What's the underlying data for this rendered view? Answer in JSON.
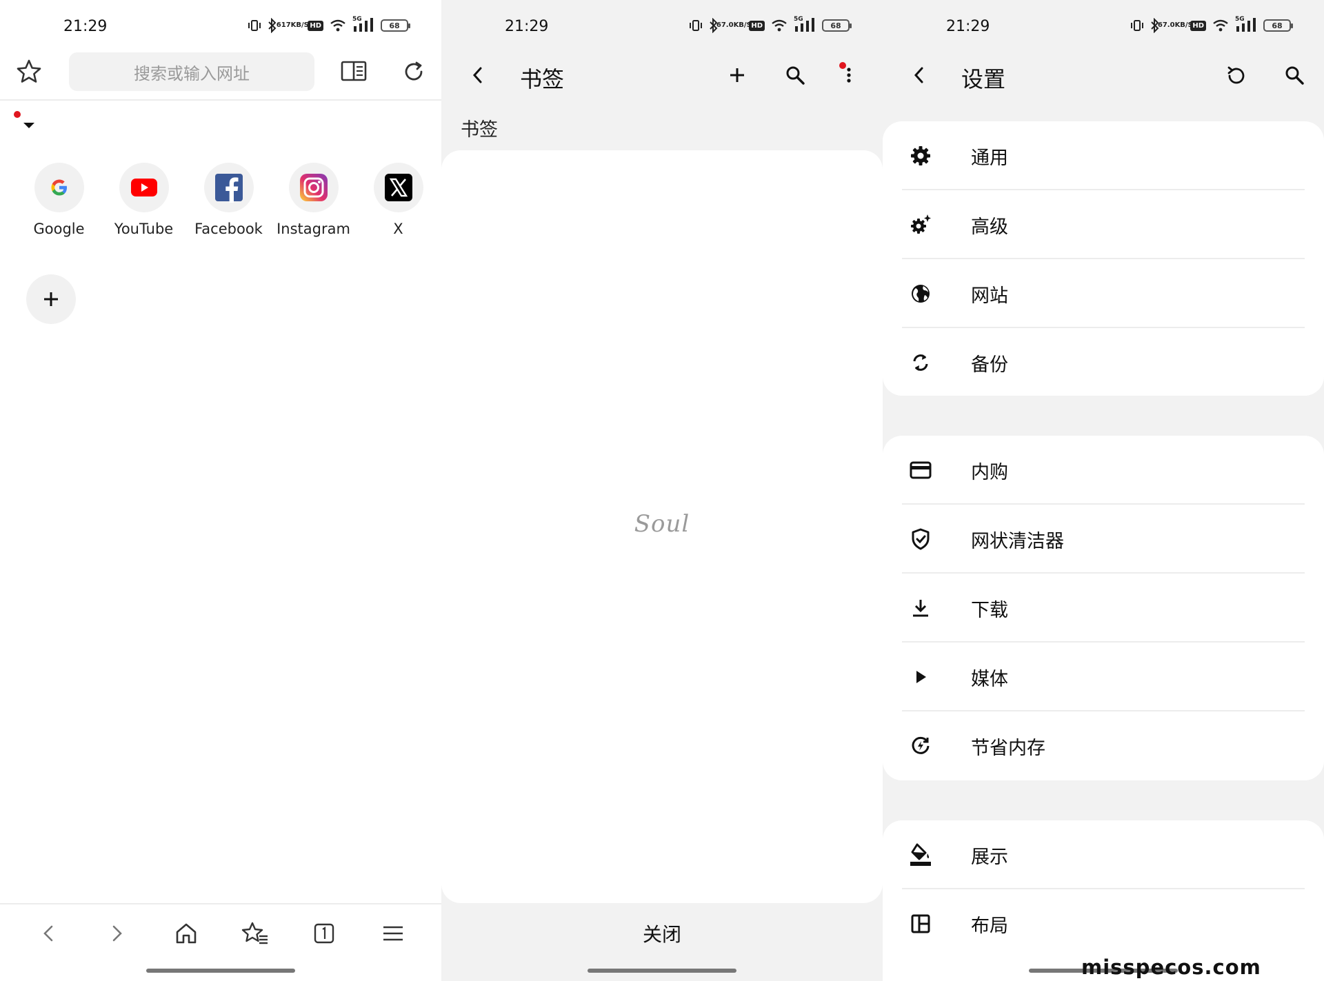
{
  "status_bar": {
    "time": "21:29",
    "panels": [
      {
        "speed_top": "617",
        "speed_bottom": "KB/S"
      },
      {
        "speed_top": "67.0",
        "speed_bottom": "KB/S"
      },
      {
        "speed_top": "67.0",
        "speed_bottom": "KB/S"
      }
    ],
    "hd": "HD",
    "network": "5G",
    "battery": "68"
  },
  "browser": {
    "search_placeholder": "搜索或输入网址",
    "shortcuts": [
      {
        "label": "Google",
        "icon": "google-icon"
      },
      {
        "label": "YouTube",
        "icon": "youtube-icon"
      },
      {
        "label": "Facebook",
        "icon": "facebook-icon"
      },
      {
        "label": "Instagram",
        "icon": "instagram-icon"
      },
      {
        "label": "X",
        "icon": "x-icon"
      }
    ],
    "colors": {
      "accent_red": "#e0161f",
      "youtube": "#ff0000",
      "facebook": "#3b5998"
    }
  },
  "bookmarks": {
    "title": "书签",
    "breadcrumb": "书签",
    "empty_logo": "Soul",
    "close_label": "关闭"
  },
  "settings": {
    "title": "设置",
    "groups": [
      [
        {
          "label": "通用",
          "icon": "gear-icon"
        },
        {
          "label": "高级",
          "icon": "gear-sparkle-icon"
        },
        {
          "label": "网站",
          "icon": "globe-icon"
        },
        {
          "label": "备份",
          "icon": "sync-icon"
        }
      ],
      [
        {
          "label": "内购",
          "icon": "credit-card-icon"
        },
        {
          "label": "网状清洁器",
          "icon": "shield-check-icon"
        },
        {
          "label": "下载",
          "icon": "download-icon"
        },
        {
          "label": "媒体",
          "icon": "play-icon"
        },
        {
          "label": "节省内存",
          "icon": "memory-saver-icon"
        }
      ],
      [
        {
          "label": "展示",
          "icon": "paint-bucket-icon"
        },
        {
          "label": "布局",
          "icon": "layout-icon"
        }
      ]
    ]
  },
  "watermark": "misspecos.com"
}
